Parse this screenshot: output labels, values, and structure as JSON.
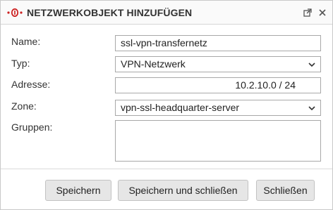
{
  "dialog": {
    "title": "NETZWERKOBJEKT HINZUFÜGEN",
    "icons": [
      "logo-icon",
      "popout-icon",
      "close-icon"
    ]
  },
  "form": {
    "name_label": "Name:",
    "name_value": "ssl-vpn-transfernetz",
    "typ_label": "Typ:",
    "typ_value": "VPN-Netzwerk",
    "adresse_label": "Adresse:",
    "adresse_value": "10.2.10.0 / 24",
    "zone_label": "Zone:",
    "zone_value": "vpn-ssl-headquarter-server",
    "gruppen_label": "Gruppen:"
  },
  "buttons": {
    "save": "Speichern",
    "save_close": "Speichern und schließen",
    "close": "Schließen"
  },
  "colors": {
    "brand_red": "#cc1f1f"
  }
}
